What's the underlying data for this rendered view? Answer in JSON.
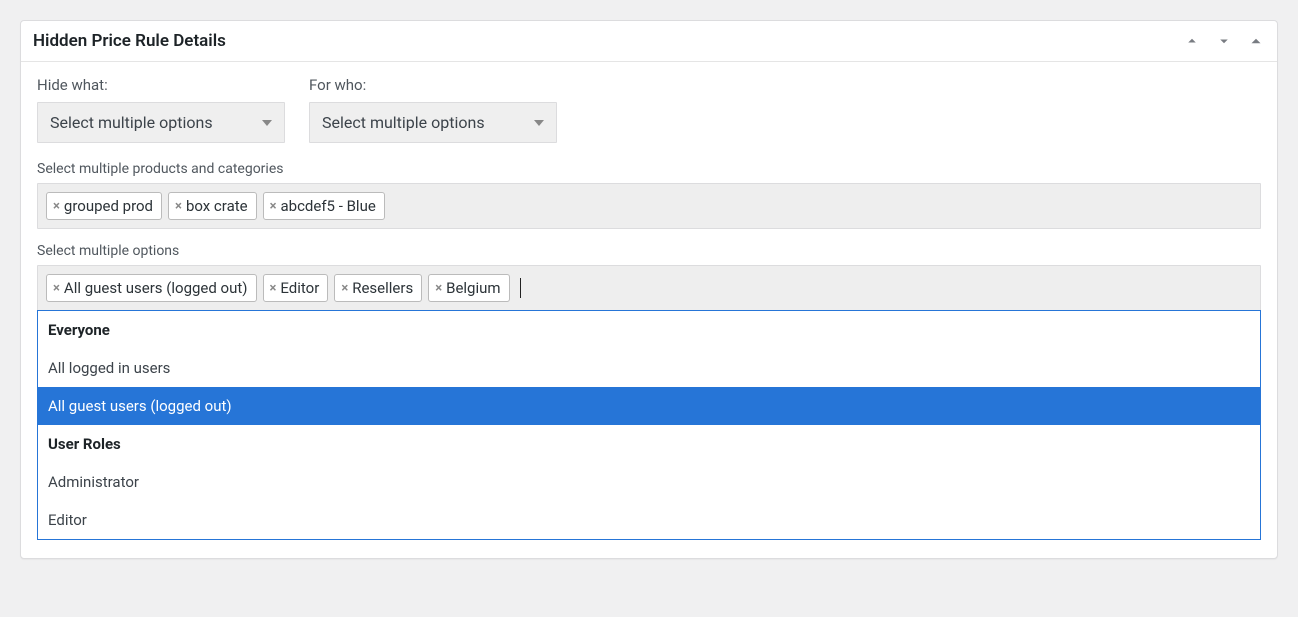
{
  "panel": {
    "title": "Hidden Price Rule Details"
  },
  "hide_what": {
    "label": "Hide what:",
    "placeholder": "Select multiple options"
  },
  "for_who": {
    "label": "For who:",
    "placeholder": "Select multiple options"
  },
  "products_section": {
    "label": "Select multiple products and categories",
    "tags": [
      "grouped prod",
      "box crate",
      "abcdef5 - Blue"
    ]
  },
  "options_section": {
    "label": "Select multiple options",
    "tags": [
      "All guest users (logged out)",
      "Editor",
      "Resellers",
      "Belgium"
    ]
  },
  "dropdown": {
    "groups": [
      {
        "title": "Everyone",
        "items": [
          {
            "label": "All logged in users",
            "highlighted": false
          },
          {
            "label": "All guest users (logged out)",
            "highlighted": true
          }
        ]
      },
      {
        "title": "User Roles",
        "items": [
          {
            "label": "Administrator",
            "highlighted": false
          },
          {
            "label": "Editor",
            "highlighted": false
          }
        ]
      }
    ]
  }
}
